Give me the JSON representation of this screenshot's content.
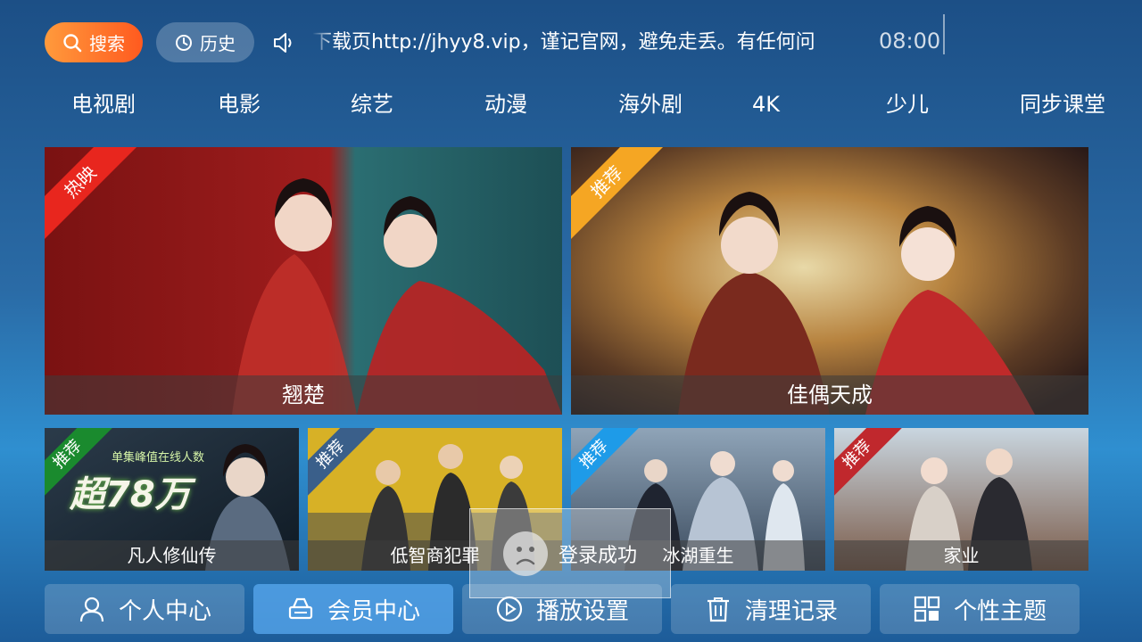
{
  "topbar": {
    "search_label": "搜索",
    "history_label": "历史",
    "marquee_text": "下载页http://jhyy8.vip，谨记官网，避免走丢。有任何问",
    "clock": "08:00"
  },
  "nav": {
    "items": [
      "电视剧",
      "电影",
      "综艺",
      "动漫",
      "海外剧",
      "4K",
      "少儿",
      "同步课堂"
    ]
  },
  "featured": [
    {
      "title": "翘楚",
      "badge": "热映",
      "badge_color": "#e8261e"
    },
    {
      "title": "佳偶天成",
      "badge": "推荐",
      "badge_color": "#f5a623"
    }
  ],
  "recommended": [
    {
      "title": "凡人修仙传",
      "badge": "推荐",
      "badge_color": "#1a8a2e",
      "poster_text": "超78万",
      "poster_sub": "单集峰值在线人数"
    },
    {
      "title": "低智商犯罪",
      "badge": "推荐",
      "badge_color": "#3a5f8a"
    },
    {
      "title": "冰湖重生",
      "badge": "推荐",
      "badge_color": "#1e9be8"
    },
    {
      "title": "家业",
      "badge": "推荐",
      "badge_color": "#c0282d"
    }
  ],
  "bottom": {
    "items": [
      {
        "label": "个人中心",
        "icon": "user-icon"
      },
      {
        "label": "会员中心",
        "icon": "vip-icon"
      },
      {
        "label": "播放设置",
        "icon": "play-icon"
      },
      {
        "label": "清理记录",
        "icon": "trash-icon"
      },
      {
        "label": "个性主题",
        "icon": "theme-icon"
      }
    ]
  },
  "toast": {
    "message": "登录成功"
  }
}
